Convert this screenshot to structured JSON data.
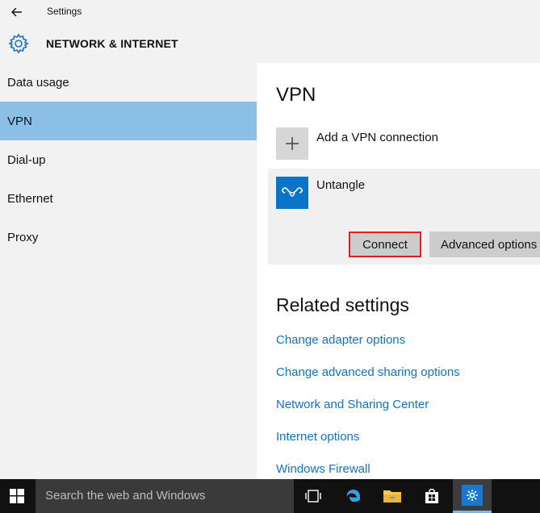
{
  "window": {
    "app_title": "Settings"
  },
  "header": {
    "section_title": "NETWORK & INTERNET"
  },
  "sidebar": {
    "items": [
      {
        "label": "Data usage"
      },
      {
        "label": "VPN"
      },
      {
        "label": "Dial-up"
      },
      {
        "label": "Ethernet"
      },
      {
        "label": "Proxy"
      }
    ],
    "selected": "VPN"
  },
  "main": {
    "title": "VPN",
    "add_connection_label": "Add a VPN connection",
    "connections": [
      {
        "name": "Untangle",
        "connect_label": "Connect",
        "advanced_label": "Advanced options"
      }
    ],
    "related_title": "Related settings",
    "related_links": [
      "Change adapter options",
      "Change advanced sharing options",
      "Network and Sharing Center",
      "Internet options",
      "Windows Firewall"
    ]
  },
  "taskbar": {
    "search_placeholder": "Search the web and Windows",
    "icons": [
      "task-view-icon",
      "edge-icon",
      "file-explorer-icon",
      "store-icon",
      "settings-icon"
    ]
  },
  "colors": {
    "selected_nav": "#8bbfe6",
    "link": "#1372c7",
    "accent": "#0a74c9",
    "highlight_border": "#e02020"
  }
}
